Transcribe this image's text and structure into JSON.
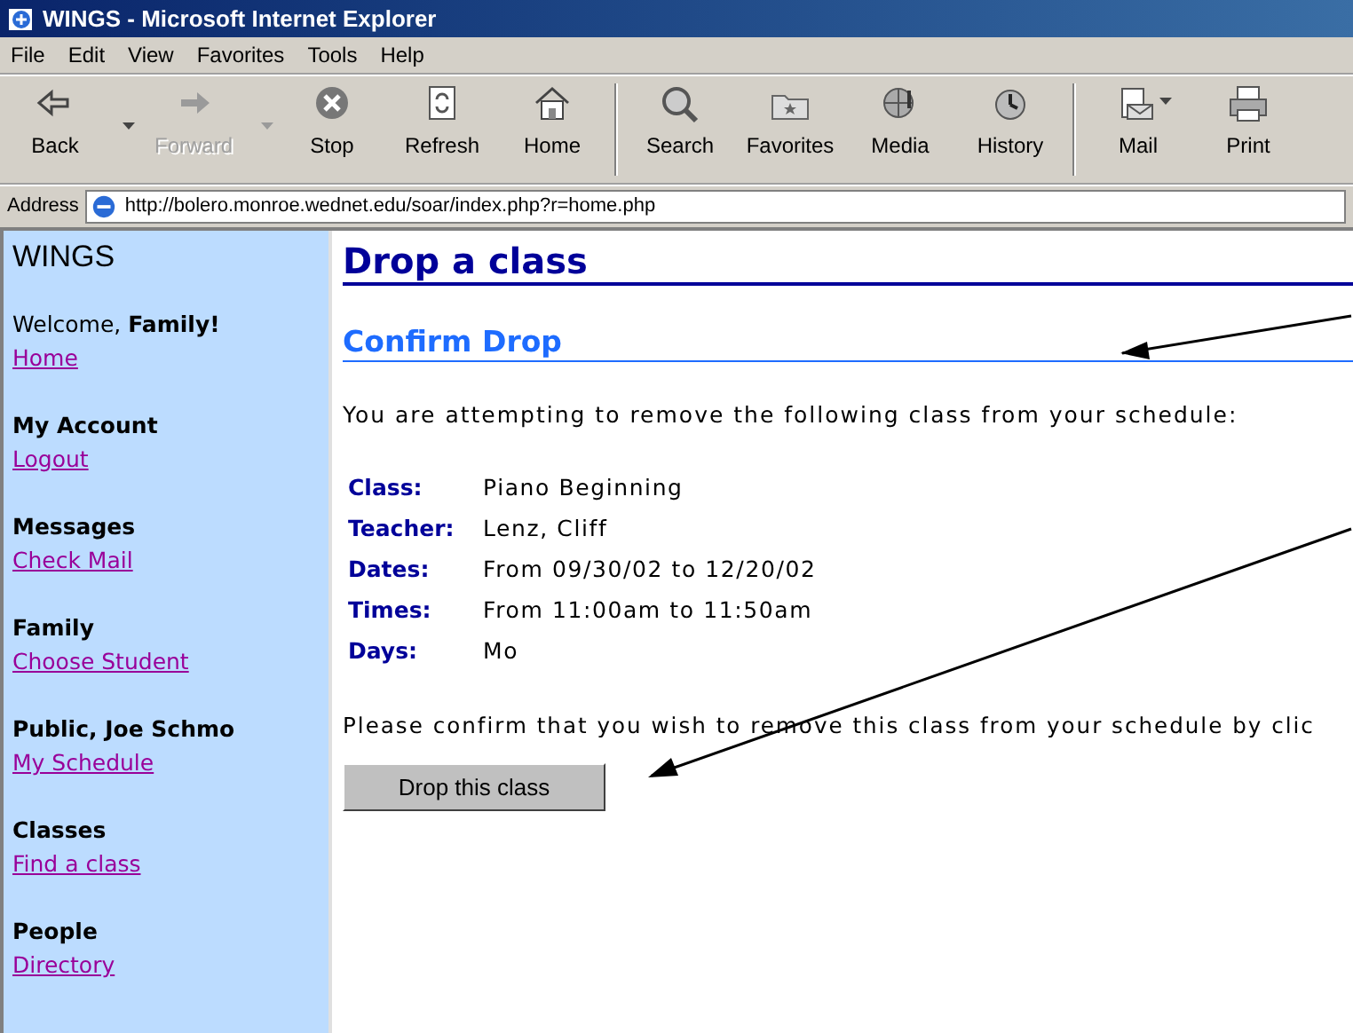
{
  "window": {
    "title": "WINGS - Microsoft Internet Explorer"
  },
  "menu": [
    "File",
    "Edit",
    "View",
    "Favorites",
    "Tools",
    "Help"
  ],
  "toolbar": [
    {
      "label": "Back",
      "kind": "back",
      "disabled": false,
      "dropdown": true
    },
    {
      "label": "Forward",
      "kind": "forward",
      "disabled": true,
      "dropdown": true
    },
    {
      "label": "Stop",
      "kind": "stop",
      "disabled": false,
      "dropdown": false
    },
    {
      "label": "Refresh",
      "kind": "refresh",
      "disabled": false,
      "dropdown": false
    },
    {
      "label": "Home",
      "kind": "home",
      "disabled": false,
      "dropdown": false
    },
    {
      "label": "Search",
      "kind": "search",
      "disabled": false,
      "dropdown": false
    },
    {
      "label": "Favorites",
      "kind": "favorites",
      "disabled": false,
      "dropdown": false
    },
    {
      "label": "Media",
      "kind": "media",
      "disabled": false,
      "dropdown": false
    },
    {
      "label": "History",
      "kind": "history",
      "disabled": false,
      "dropdown": false
    },
    {
      "label": "Mail",
      "kind": "mail",
      "disabled": false,
      "dropdown": true
    },
    {
      "label": "Print",
      "kind": "print",
      "disabled": false,
      "dropdown": false
    }
  ],
  "address": {
    "label": "Address",
    "url": "http://bolero.monroe.wednet.edu/soar/index.php?r=home.php"
  },
  "sidebar": {
    "title": "WINGS",
    "sections": [
      {
        "heading": "Welcome, **Family!**",
        "link": "Home"
      },
      {
        "heading": "My Account",
        "link": "Logout"
      },
      {
        "heading": "Messages",
        "link": "Check Mail"
      },
      {
        "heading": "Family",
        "link": "Choose Student"
      },
      {
        "heading": "Public, Joe Schmo",
        "link": "My Schedule"
      },
      {
        "heading": "Classes",
        "link": "Find a class"
      },
      {
        "heading": "People",
        "link": "Directory"
      }
    ]
  },
  "main": {
    "title": "Drop a class",
    "subtitle": "Confirm Drop",
    "intro": "You are attempting to remove the following class from your schedule:",
    "details": [
      {
        "label": "Class:",
        "value": "Piano Beginning"
      },
      {
        "label": "Teacher:",
        "value": "Lenz, Cliff"
      },
      {
        "label": "Dates:",
        "value": "From 09/30/02 to 12/20/02"
      },
      {
        "label": "Times:",
        "value": "From 11:00am to 11:50am"
      },
      {
        "label": "Days:",
        "value": "Mo"
      }
    ],
    "confirm": "Please confirm that you wish to remove this class from your schedule by clic",
    "button": "Drop this class"
  }
}
